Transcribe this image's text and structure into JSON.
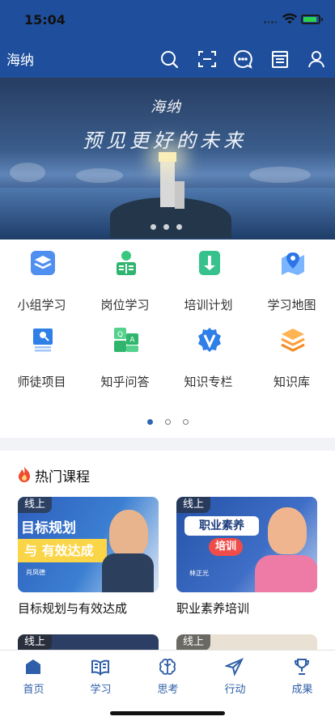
{
  "status_bar": {
    "time": "15:04"
  },
  "header": {
    "brand": "海纳",
    "icons": [
      "search-icon",
      "scan-icon",
      "message-icon",
      "calendar-icon",
      "user-icon"
    ]
  },
  "banner": {
    "title": "海纳",
    "slogan": "预见更好的未来",
    "slide_count": 3
  },
  "menu": {
    "items": [
      {
        "label": "小组学习",
        "icon": "layers-icon"
      },
      {
        "label": "岗位学习",
        "icon": "reader-icon"
      },
      {
        "label": "培训计划",
        "icon": "download-icon"
      },
      {
        "label": "学习地图",
        "icon": "map-pin-icon"
      },
      {
        "label": "师徒项目",
        "icon": "mentor-icon"
      },
      {
        "label": "知乎问答",
        "icon": "qa-icon"
      },
      {
        "label": "知识专栏",
        "icon": "v-badge-icon"
      },
      {
        "label": "知识库",
        "icon": "stack-icon"
      }
    ],
    "pages": 3,
    "active_page": 1
  },
  "hot_courses": {
    "title": "热门课程",
    "courses": [
      {
        "tag": "线上",
        "title": "目标规划与有效达成",
        "poster_title": "目标规划",
        "poster_subtitle": "与 有效达成",
        "instructor": "肖凤德"
      },
      {
        "tag": "线上",
        "title": "职业素养培训",
        "poster_title": "职业素养",
        "poster_subtitle": "培训",
        "instructor": "林正光"
      },
      {
        "tag": "线上"
      },
      {
        "tag": "线上"
      }
    ]
  },
  "tabbar": {
    "tabs": [
      {
        "label": "首页",
        "icon": "home-icon"
      },
      {
        "label": "学习",
        "icon": "book-icon"
      },
      {
        "label": "思考",
        "icon": "brain-icon"
      },
      {
        "label": "行动",
        "icon": "send-icon"
      },
      {
        "label": "成果",
        "icon": "trophy-icon"
      }
    ],
    "active": "首页"
  },
  "colors": {
    "header": "#1f4f9c",
    "accent": "#2e5fa8",
    "divider": "#f1f3f7"
  }
}
